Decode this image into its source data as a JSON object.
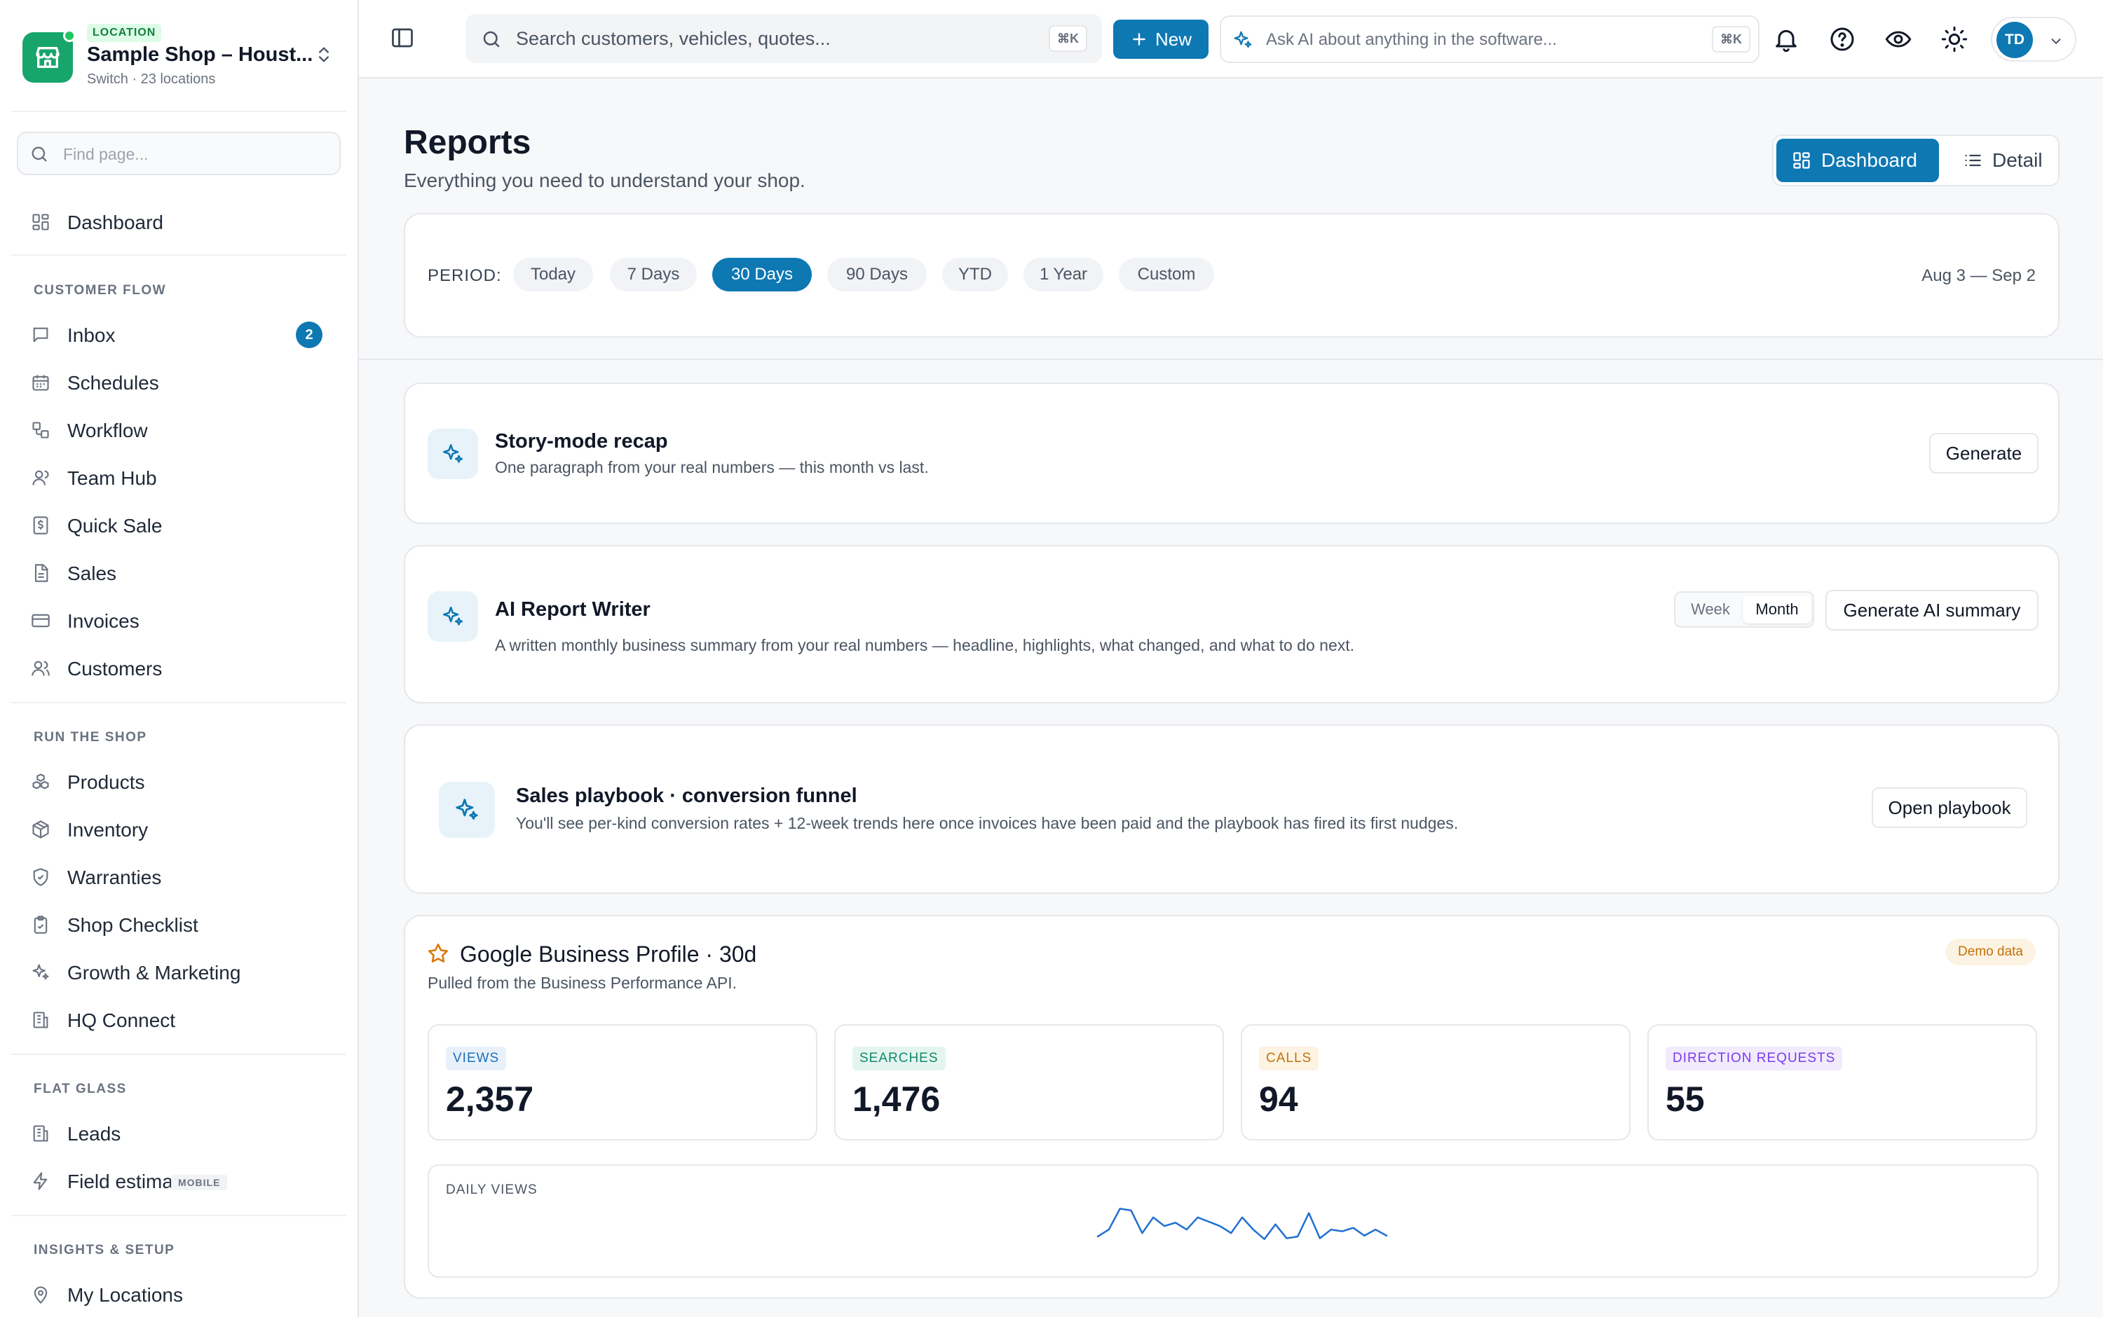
{
  "location": {
    "badge": "LOCATION",
    "name": "Sample Shop – Houst...",
    "sub": "Switch · 23 locations"
  },
  "sidebar": {
    "find_placeholder": "Find page...",
    "dashboard": "Dashboard",
    "sections": [
      {
        "title": "CUSTOMER FLOW",
        "items": [
          {
            "label": "Inbox",
            "icon": "inbox-icon",
            "count": "2"
          },
          {
            "label": "Schedules",
            "icon": "calendar-icon"
          },
          {
            "label": "Workflow",
            "icon": "workflow-icon"
          },
          {
            "label": "Team Hub",
            "icon": "user-icon"
          },
          {
            "label": "Quick Sale",
            "icon": "dollar-receipt-icon"
          },
          {
            "label": "Sales",
            "icon": "document-icon"
          },
          {
            "label": "Invoices",
            "icon": "credit-card-icon"
          },
          {
            "label": "Customers",
            "icon": "users-icon"
          }
        ]
      },
      {
        "title": "RUN THE SHOP",
        "items": [
          {
            "label": "Products",
            "icon": "boxes-icon"
          },
          {
            "label": "Inventory",
            "icon": "package-icon"
          },
          {
            "label": "Warranties",
            "icon": "shield-check-icon"
          },
          {
            "label": "Shop Checklist",
            "icon": "clipboard-check-icon"
          },
          {
            "label": "Growth & Marketing",
            "icon": "sparkles-icon"
          },
          {
            "label": "HQ Connect",
            "icon": "building-icon"
          }
        ]
      },
      {
        "title": "FLAT GLASS",
        "items": [
          {
            "label": "Leads",
            "icon": "building-icon"
          },
          {
            "label": "Field estimator",
            "icon": "bolt-icon",
            "tag": "MOBILE"
          }
        ]
      },
      {
        "title": "INSIGHTS & SETUP",
        "items": [
          {
            "label": "My Locations",
            "icon": "map-pin-icon"
          }
        ]
      }
    ]
  },
  "topbar": {
    "search_placeholder": "Search customers, vehicles, quotes...",
    "search_kbd": "⌘K",
    "new_label": "New",
    "ai_placeholder": "Ask AI about anything in the software...",
    "ai_kbd": "⌘K",
    "avatar_initials": "TD"
  },
  "page": {
    "title": "Reports",
    "subtitle": "Everything you need to understand your shop.",
    "view_dashboard": "Dashboard",
    "view_detail": "Detail"
  },
  "period": {
    "label": "PERIOD:",
    "options": [
      "Today",
      "7 Days",
      "30 Days",
      "90 Days",
      "YTD",
      "1 Year",
      "Custom"
    ],
    "selected": "30 Days",
    "range": "Aug 3 — Sep 2"
  },
  "recap": {
    "title": "Story-mode recap",
    "subtitle": "One paragraph from your real numbers — this month vs last.",
    "button": "Generate"
  },
  "writer": {
    "title": "AI Report Writer",
    "subtitle": "A written monthly business summary from your real numbers — headline, highlights, what changed, and what to do next.",
    "toggle_week": "Week",
    "toggle_month": "Month",
    "selected": "Month",
    "button": "Generate AI summary"
  },
  "playbook": {
    "title": "Sales playbook · conversion funnel",
    "subtitle": "You'll see per-kind conversion rates + 12-week trends here once invoices have been paid and the playbook has fired its first nudges.",
    "button": "Open playbook"
  },
  "gbp": {
    "title": "Google Business Profile · 30d",
    "subtitle": "Pulled from the Business Performance API.",
    "demo_badge": "Demo data",
    "metrics": [
      {
        "label": "VIEWS",
        "value": "2,357",
        "color": "#1d6fb8",
        "bg": "#e8f1fb"
      },
      {
        "label": "SEARCHES",
        "value": "1,476",
        "color": "#0f8a6a",
        "bg": "#e4f5ef"
      },
      {
        "label": "CALLS",
        "value": "94",
        "color": "#c2710c",
        "bg": "#fdf3e2"
      },
      {
        "label": "DIRECTION REQUESTS",
        "value": "55",
        "color": "#7c3aed",
        "bg": "#f1ebfd"
      }
    ],
    "chart_label": "DAILY VIEWS"
  },
  "chart_data": {
    "type": "line",
    "title": "DAILY VIEWS",
    "series": [
      {
        "values": [
          62,
          70,
          94,
          92,
          66,
          84,
          74,
          78,
          70,
          84,
          79,
          74,
          66,
          84,
          70,
          59,
          76,
          60,
          62,
          89,
          60,
          70,
          68,
          72,
          63,
          70,
          63
        ]
      }
    ],
    "ylim": [
      50,
      100
    ],
    "grid": false,
    "color": "#1f6fd1"
  },
  "colors": {
    "accent": "#0e78b3",
    "brand_green": "#17a56b",
    "star": "#d97706"
  }
}
